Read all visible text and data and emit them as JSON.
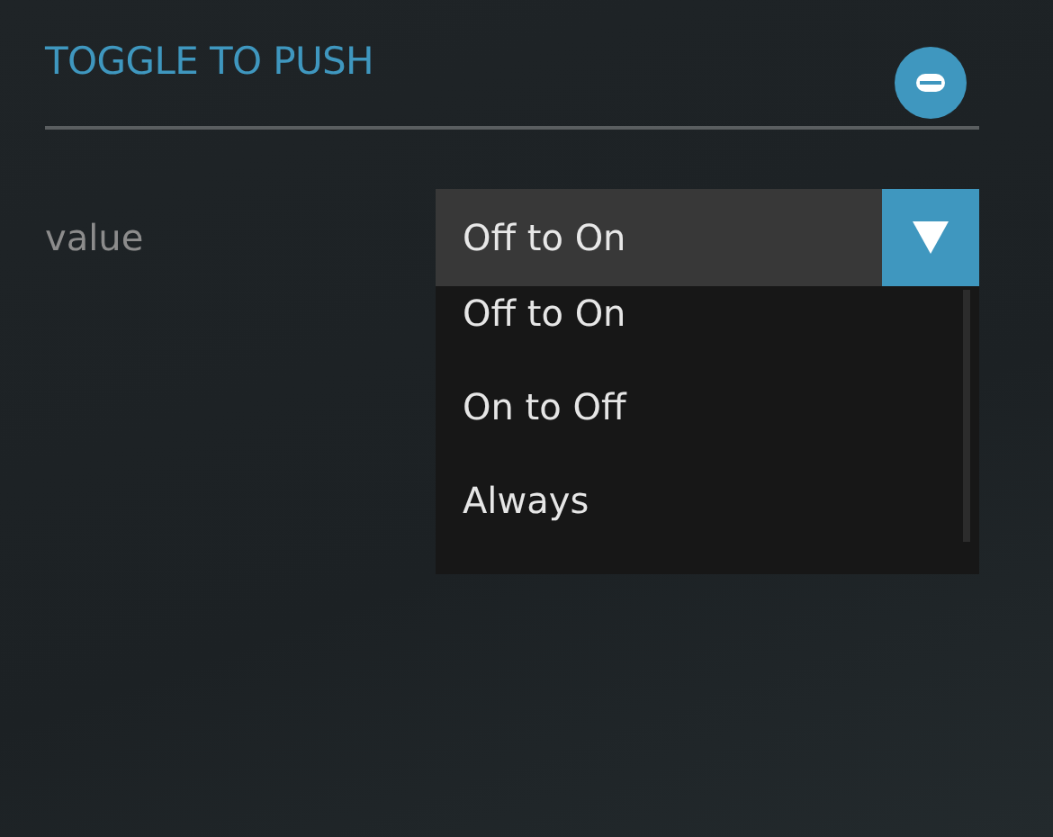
{
  "section": {
    "title": "TOGGLE TO PUSH"
  },
  "setting": {
    "label": "value",
    "value": "Off to On",
    "expanded": true,
    "options": [
      "Off to On",
      "On to Off",
      "Always"
    ]
  }
}
